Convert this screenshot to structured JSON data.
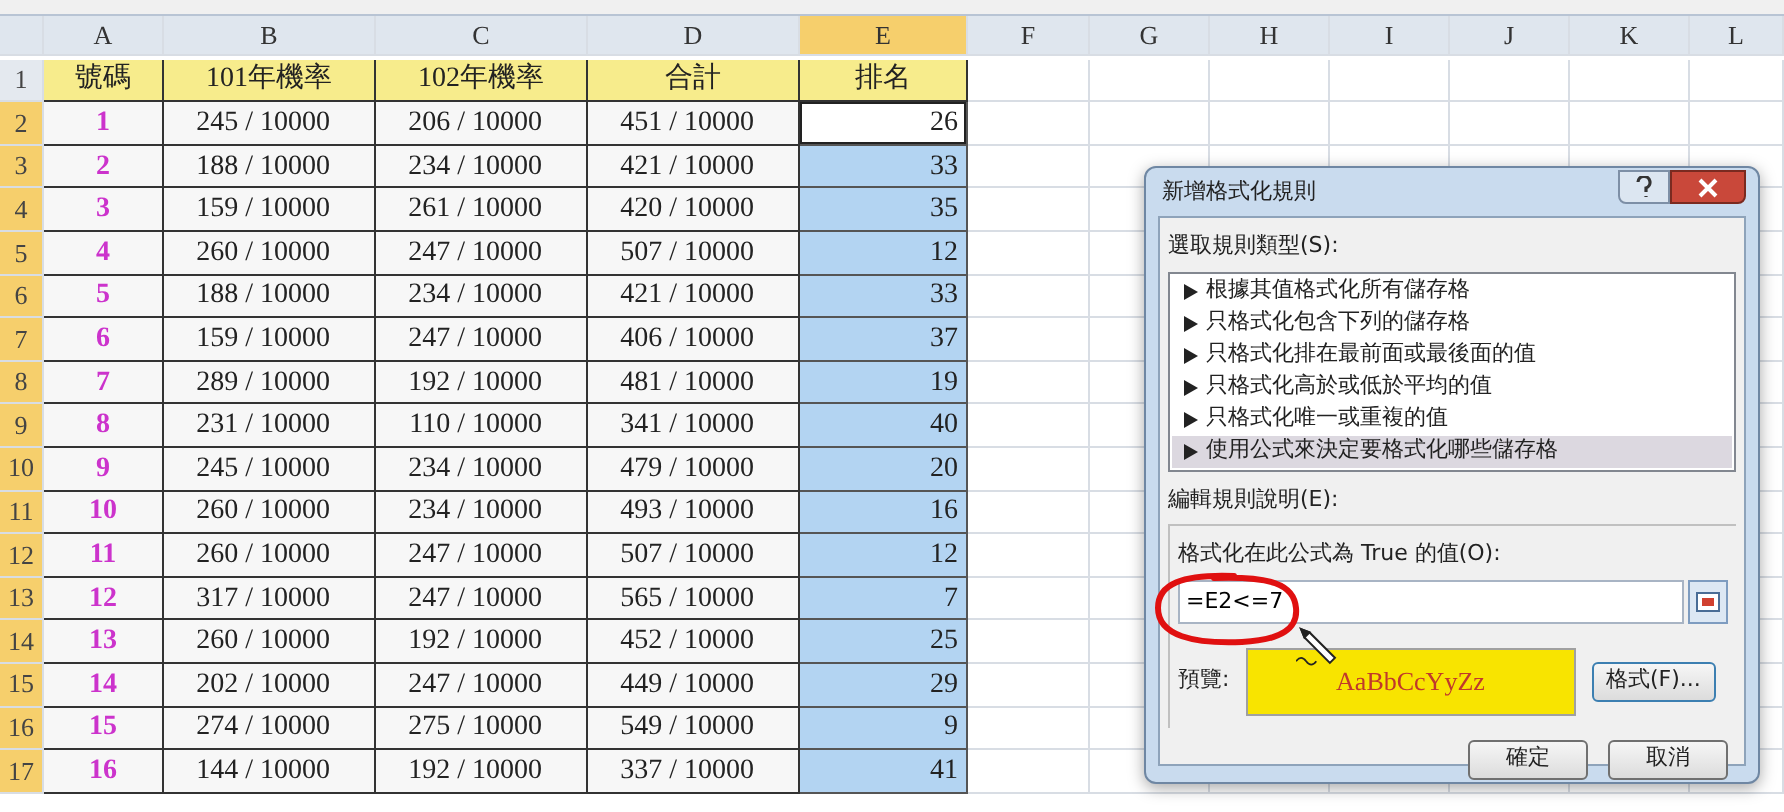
{
  "sheet": {
    "columns": [
      {
        "label": "A",
        "selected": false
      },
      {
        "label": "B",
        "selected": false
      },
      {
        "label": "C",
        "selected": false
      },
      {
        "label": "D",
        "selected": false
      },
      {
        "label": "E",
        "selected": true
      },
      {
        "label": "F",
        "selected": false
      },
      {
        "label": "G",
        "selected": false
      },
      {
        "label": "H",
        "selected": false
      },
      {
        "label": "I",
        "selected": false
      },
      {
        "label": "J",
        "selected": false
      },
      {
        "label": "K",
        "selected": false
      },
      {
        "label": "L",
        "selected": false
      }
    ],
    "rows": [
      {
        "number": "1",
        "kind": "header",
        "selected": false,
        "cells": [
          "號碼",
          "101年機率",
          "102年機率",
          "合計",
          "排名"
        ]
      },
      {
        "number": "2",
        "kind": "data",
        "selected": true,
        "active": true,
        "cells": [
          "1",
          "245 / 10000",
          "206 / 10000",
          "451 / 10000",
          "26"
        ]
      },
      {
        "number": "3",
        "kind": "data",
        "selected": true,
        "active": false,
        "cells": [
          "2",
          "188 / 10000",
          "234 / 10000",
          "421 / 10000",
          "33"
        ]
      },
      {
        "number": "4",
        "kind": "data",
        "selected": true,
        "active": false,
        "cells": [
          "3",
          "159 / 10000",
          "261 / 10000",
          "420 / 10000",
          "35"
        ]
      },
      {
        "number": "5",
        "kind": "data",
        "selected": true,
        "active": false,
        "cells": [
          "4",
          "260 / 10000",
          "247 / 10000",
          "507 / 10000",
          "12"
        ]
      },
      {
        "number": "6",
        "kind": "data",
        "selected": true,
        "active": false,
        "cells": [
          "5",
          "188 / 10000",
          "234 / 10000",
          "421 / 10000",
          "33"
        ]
      },
      {
        "number": "7",
        "kind": "data",
        "selected": true,
        "active": false,
        "cells": [
          "6",
          "159 / 10000",
          "247 / 10000",
          "406 / 10000",
          "37"
        ]
      },
      {
        "number": "8",
        "kind": "data",
        "selected": true,
        "active": false,
        "cells": [
          "7",
          "289 / 10000",
          "192 / 10000",
          "481 / 10000",
          "19"
        ]
      },
      {
        "number": "9",
        "kind": "data",
        "selected": true,
        "active": false,
        "cells": [
          "8",
          "231 / 10000",
          "110 / 10000",
          "341 / 10000",
          "40"
        ]
      },
      {
        "number": "10",
        "kind": "data",
        "selected": true,
        "active": false,
        "cells": [
          "9",
          "245 / 10000",
          "234 / 10000",
          "479 / 10000",
          "20"
        ]
      },
      {
        "number": "11",
        "kind": "data",
        "selected": true,
        "active": false,
        "cells": [
          "10",
          "260 / 10000",
          "234 / 10000",
          "493 / 10000",
          "16"
        ]
      },
      {
        "number": "12",
        "kind": "data",
        "selected": true,
        "active": false,
        "cells": [
          "11",
          "260 / 10000",
          "247 / 10000",
          "507 / 10000",
          "12"
        ]
      },
      {
        "number": "13",
        "kind": "data",
        "selected": true,
        "active": false,
        "cells": [
          "12",
          "317 / 10000",
          "247 / 10000",
          "565 / 10000",
          "7"
        ]
      },
      {
        "number": "14",
        "kind": "data",
        "selected": true,
        "active": false,
        "cells": [
          "13",
          "260 / 10000",
          "192 / 10000",
          "452 / 10000",
          "25"
        ]
      },
      {
        "number": "15",
        "kind": "data",
        "selected": true,
        "active": false,
        "cells": [
          "14",
          "202 / 10000",
          "247 / 10000",
          "449 / 10000",
          "29"
        ]
      },
      {
        "number": "16",
        "kind": "data",
        "selected": true,
        "active": false,
        "cells": [
          "15",
          "274 / 10000",
          "275 / 10000",
          "549 / 10000",
          "9"
        ]
      },
      {
        "number": "17",
        "kind": "data",
        "selected": true,
        "active": false,
        "cells": [
          "16",
          "144 / 10000",
          "192 / 10000",
          "337 / 10000",
          "41"
        ]
      }
    ]
  },
  "dialog": {
    "title": "新增格式化規則",
    "rule_type_label": "選取規則類型(S):",
    "rule_types": [
      {
        "label": "根據其值格式化所有儲存格",
        "selected": false
      },
      {
        "label": "只格式化包含下列的儲存格",
        "selected": false
      },
      {
        "label": "只格式化排在最前面或最後面的值",
        "selected": false
      },
      {
        "label": "只格式化高於或低於平均的值",
        "selected": false
      },
      {
        "label": "只格式化唯一或重複的值",
        "selected": false
      },
      {
        "label": "使用公式來決定要格式化哪些儲存格",
        "selected": true
      }
    ],
    "description_label": "編輯規則說明(E):",
    "formula_label": "格式化在此公式為 True 的值(O):",
    "formula": "=E2<=7",
    "preview_label": "預覽:",
    "preview_text": "AaBbCcYyZz",
    "buttons": {
      "format": "格式(F)...",
      "ok": "確定",
      "cancel": "取消"
    }
  }
}
